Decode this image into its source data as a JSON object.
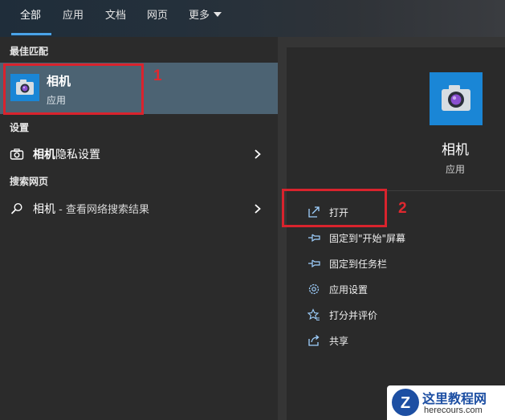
{
  "tabs": [
    {
      "label": "全部"
    },
    {
      "label": "应用"
    },
    {
      "label": "文档"
    },
    {
      "label": "网页"
    },
    {
      "label": "更多"
    }
  ],
  "left": {
    "best_match_label": "最佳匹配",
    "best_match": {
      "title": "相机",
      "subtitle": "应用",
      "icon": "camera-icon"
    },
    "settings_label": "设置",
    "settings_item": {
      "bold": "相机",
      "rest": "隐私设置",
      "icon": "camera-outline-icon"
    },
    "web_label": "搜索网页",
    "web_item": {
      "text": "相机",
      "muted": " - 查看网络搜索结果",
      "icon": "search-icon"
    }
  },
  "right": {
    "title": "相机",
    "subtitle": "应用",
    "actions": [
      {
        "label": "打开",
        "icon": "open-icon"
      },
      {
        "label": "固定到\"开始\"屏幕",
        "icon": "pin-icon"
      },
      {
        "label": "固定到任务栏",
        "icon": "pin-icon"
      },
      {
        "label": "应用设置",
        "icon": "gear-icon"
      },
      {
        "label": "打分并评价",
        "icon": "star-icon"
      },
      {
        "label": "共享",
        "icon": "share-icon"
      }
    ]
  },
  "annotations": {
    "one": "1",
    "two": "2"
  },
  "watermark": {
    "name": "这里教程网",
    "domain": "herecours.com",
    "logo_letter": "Z"
  },
  "colors": {
    "accent": "#4aa3e8",
    "selected": "#4c6373",
    "icon_bg": "#1a86d6",
    "highlight": "#d9232d"
  }
}
